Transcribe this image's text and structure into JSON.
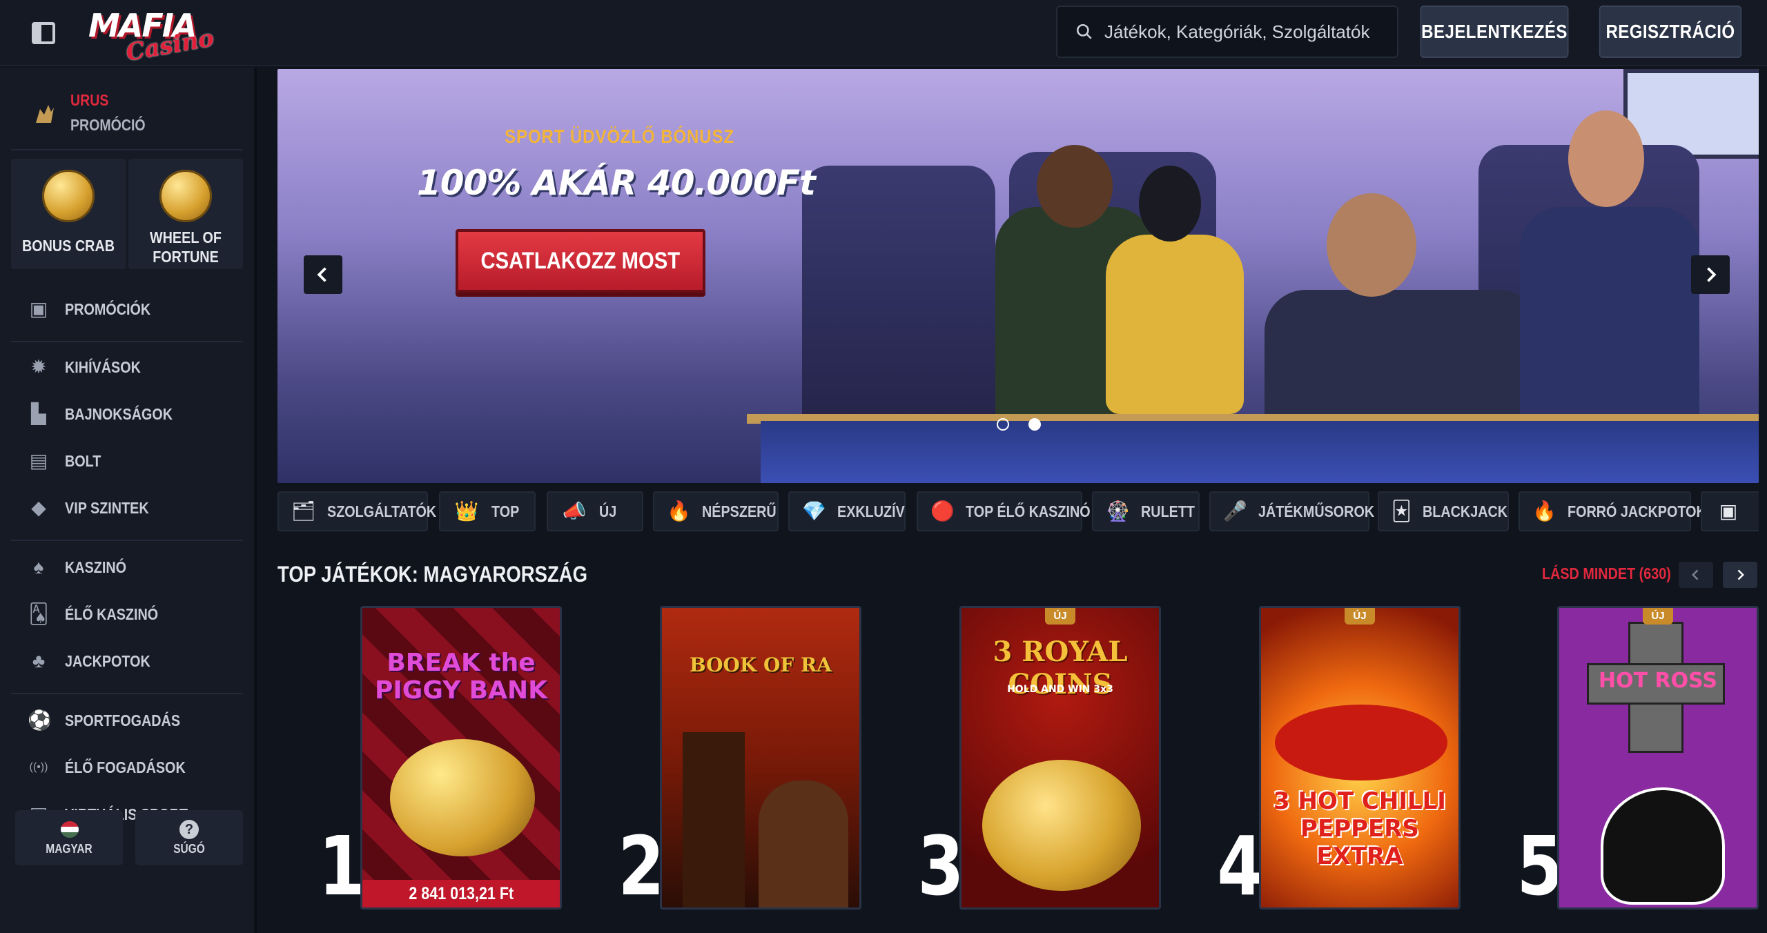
{
  "header": {
    "logo_main": "MAFIA",
    "logo_sub": "Casino",
    "search_placeholder": "Játékok, Kategóriák, Szolgáltatók",
    "login_label": "BEJELENTKEZÉS",
    "register_label": "REGISZTRÁCIÓ"
  },
  "sidebar": {
    "promo": {
      "title": "URUS",
      "subtitle": "PROMÓCIÓ"
    },
    "tiles": [
      {
        "label": "BONUS CRAB",
        "icon": "crab-coin-icon"
      },
      {
        "label": "WHEEL OF FORTUNE",
        "label_line1": "WHEEL OF",
        "label_line2": "FORTUNE",
        "icon": "wheel-icon"
      }
    ],
    "items": [
      {
        "label": "PROMÓCIÓK",
        "icon": "gift-icon"
      },
      {
        "label": "KIHÍVÁSOK",
        "icon": "gear-badge-icon"
      },
      {
        "label": "BAJNOKSÁGOK",
        "icon": "podium-icon"
      },
      {
        "label": "BOLT",
        "icon": "shop-icon"
      },
      {
        "label": "VIP SZINTEK",
        "icon": "diamond-icon"
      },
      {
        "label": "KASZINÓ",
        "icon": "spade-icon"
      },
      {
        "label": "ÉLŐ KASZINÓ",
        "icon": "cards-icon"
      },
      {
        "label": "JACKPOTOK",
        "icon": "clover-icon"
      },
      {
        "label": "SPORTFOGADÁS",
        "icon": "football-icon"
      },
      {
        "label": "ÉLŐ FOGADÁSOK",
        "icon": "live-icon"
      },
      {
        "label": "VIRTUÁLIS SPORT",
        "icon": "virtual-sport-icon"
      }
    ],
    "language_label": "MAGYAR",
    "help_label": "SÚGÓ"
  },
  "banner": {
    "subtitle": "SPORT ÜDVÖZLŐ BÓNUSZ",
    "title": "100% AKÁR 40.000Ft",
    "cta_label": "CSATLAKOZZ MOST",
    "slides_total": 2,
    "active_slide": 2
  },
  "categories": [
    {
      "label": "SZOLGÁLTATÓK",
      "icon": "providers-icon"
    },
    {
      "label": "TOP",
      "icon": "crown-icon"
    },
    {
      "label": "ÚJ",
      "icon": "megaphone-icon"
    },
    {
      "label": "NÉPSZERŰ",
      "icon": "fire-icon"
    },
    {
      "label": "EXKLUZÍV",
      "icon": "diamond-icon"
    },
    {
      "label": "TOP ÉLŐ KASZINÓ",
      "icon": "chip-icon"
    },
    {
      "label": "RULETT",
      "icon": "roulette-icon"
    },
    {
      "label": "JÁTÉKMŰSOROK",
      "icon": "microphone-icon"
    },
    {
      "label": "BLACKJACK",
      "icon": "blackjack-icon"
    },
    {
      "label": "FORRÓ JACKPOTOK",
      "icon": "hot-jackpot-icon"
    }
  ],
  "top_games": {
    "title": "TOP JÁTÉKOK: MAGYARORSZÁG",
    "see_all": "LÁSD MINDET (630)",
    "games": [
      {
        "rank": "1",
        "name": "BREAK the PIGGY BANK",
        "badge": "",
        "jackpot": "2 841 013,21 Ft"
      },
      {
        "rank": "2",
        "name": "BOOK OF RA",
        "badge": "",
        "jackpot": ""
      },
      {
        "rank": "3",
        "name": "3 ROYAL COINS",
        "sub": "HOLD AND WIN 3x3",
        "badge": "ÚJ",
        "jackpot": ""
      },
      {
        "rank": "4",
        "name": "3 HOT CHILLI PEPPERS EXTRA",
        "badge": "ÚJ",
        "jackpot": ""
      },
      {
        "rank": "5",
        "name": "HOT ROSS",
        "badge": "ÚJ",
        "jackpot": ""
      }
    ]
  },
  "colors": {
    "accent_red": "#e2283e",
    "gold": "#f2b43a",
    "bg": "#10141c"
  }
}
